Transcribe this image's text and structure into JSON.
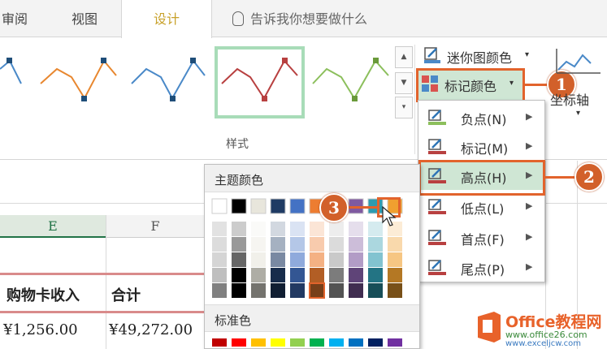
{
  "tabs": [
    {
      "label": "审阅"
    },
    {
      "label": "视图"
    },
    {
      "label": "设计"
    }
  ],
  "tell_me": "告诉我你想要做什么",
  "ribbon": {
    "group_label": "样式",
    "sparkline_color_label": "迷你图颜色",
    "marker_color_label": "标记颜色",
    "axis_label": "坐标轴"
  },
  "marker_menu": [
    {
      "label": "负点(N)"
    },
    {
      "label": "标记(M)"
    },
    {
      "label": "高点(H)"
    },
    {
      "label": "低点(L)"
    },
    {
      "label": "首点(F)"
    },
    {
      "label": "尾点(P)"
    }
  ],
  "palette": {
    "theme_label": "主题颜色",
    "standard_label": "标准色",
    "theme_colors": [
      "#ffffff",
      "#000000",
      "#e8e6dc",
      "#1f3b64",
      "#4472c4",
      "#ed7d31",
      "#a5a5a5",
      "#7f5aa0",
      "#2e9bb0",
      "#f0a030"
    ],
    "standard_colors": [
      "#c00000",
      "#ff0000",
      "#ffc000",
      "#ffff00",
      "#92d050",
      "#00b050",
      "#00b0f0",
      "#0070c0",
      "#002060",
      "#7030a0"
    ]
  },
  "sheet": {
    "columns": [
      "E",
      "F"
    ],
    "header_cells": [
      "购物卡收入",
      "合计"
    ],
    "row_cells": [
      "¥1,256.00",
      "¥49,272.00"
    ]
  },
  "callouts": [
    "1",
    "2",
    "3"
  ],
  "watermark": {
    "brand": "Office教程网",
    "url1": "www.office26.com",
    "url2": "www.exceljcw.com"
  }
}
